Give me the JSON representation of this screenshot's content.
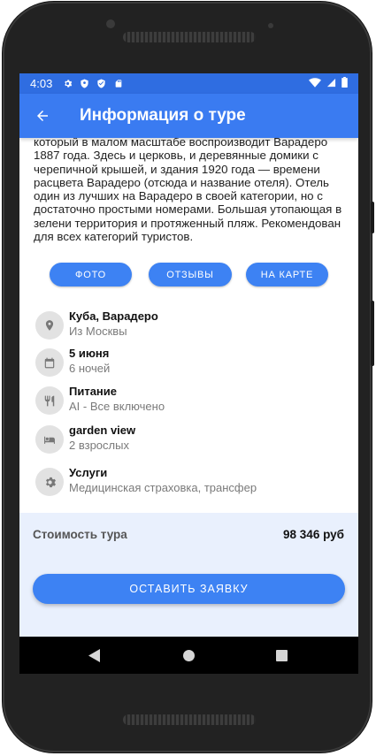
{
  "status_bar": {
    "time": "4:03",
    "icons": [
      "gear-icon",
      "shield-icon",
      "shield-icon",
      "sd-card-icon",
      "wifi-icon",
      "signal-icon",
      "battery-icon"
    ]
  },
  "app_bar": {
    "back_icon": "arrow-left-icon",
    "title": "Информация о туре",
    "color": "#3a7bf1"
  },
  "description": "который в малом масштабе воспроизводит Варадеро 1887 года. Здесь и церковь, и деревянные домики с черепичной крышей, и здания 1920 года — времени расцвета Варадеро (отсюда и название отеля). Отель один из лучших на Варадеро в своей категории, но с достаточно простыми номерами. Большая утопающая в зелени территория и протяженный пляж. Рекомендован для всех категорий туристов.",
  "action_buttons": {
    "photo": "ФОТО",
    "reviews": "ОТЗЫВЫ",
    "map": "НА КАРТЕ"
  },
  "details": [
    {
      "icon": "location-pin-icon",
      "title": "Куба, Варадеро",
      "subtitle": "Из Москвы"
    },
    {
      "icon": "calendar-icon",
      "title": "5 июня",
      "subtitle": "6 ночей"
    },
    {
      "icon": "cutlery-icon",
      "title": "Питание",
      "subtitle": "AI - Все включено"
    },
    {
      "icon": "bed-icon",
      "title": "garden view",
      "subtitle": "2 взрослых"
    },
    {
      "icon": "gear-icon",
      "title": "Услуги",
      "subtitle": "Медицинская страховка, трансфер"
    }
  ],
  "price": {
    "label": "Стоимость тура",
    "value": "98 346 руб"
  },
  "order_button": "ОСТАВИТЬ ЗАЯВКУ",
  "nav_bar": [
    "back-triangle-icon",
    "home-circle-icon",
    "recents-square-icon"
  ]
}
